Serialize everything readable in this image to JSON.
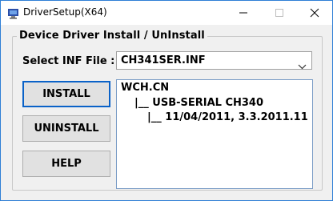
{
  "window": {
    "title": "DriverSetup(X64)",
    "controls": [
      "minimize-icon",
      "maximize-icon",
      "close-icon"
    ]
  },
  "group": {
    "legend": "Device Driver Install / UnInstall"
  },
  "inf": {
    "label": "Select INF File :",
    "selected": "CH341SER.INF"
  },
  "buttons": {
    "install": "INSTALL",
    "uninstall": "UNINSTALL",
    "help": "HELP"
  },
  "info": {
    "lines": [
      "WCH.CN",
      "|__ USB-SERIAL CH340",
      "|__ 11/04/2011, 3.3.2011.11"
    ]
  },
  "colors": {
    "window_border": "#2f7fd6",
    "focus_border": "#0a62c8",
    "info_border": "#7a9cc6"
  }
}
